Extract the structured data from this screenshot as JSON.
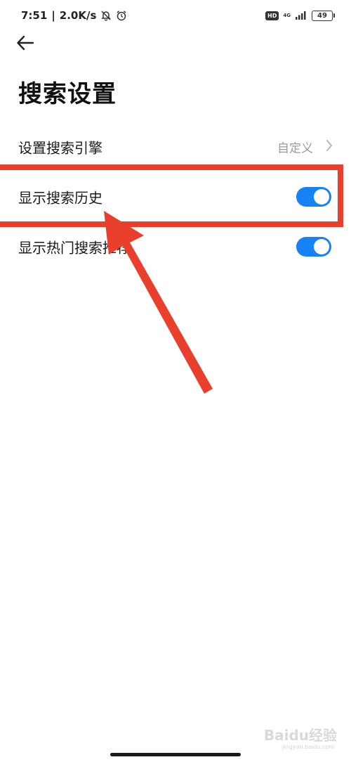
{
  "status_bar": {
    "time": "7:51",
    "network_speed": "2.0K/s",
    "hd_badge": "HD",
    "network_type": "4G",
    "battery": "49",
    "icons": [
      "notifications-off-icon",
      "alarm-icon",
      "signal-icon",
      "battery-icon"
    ]
  },
  "header": {
    "back_icon": "arrow-left-icon",
    "title": "搜索设置"
  },
  "settings": [
    {
      "label": "设置搜索引擎",
      "value": "自定义",
      "type": "link"
    },
    {
      "label": "显示搜索历史",
      "type": "toggle",
      "on": true
    },
    {
      "label": "显示热门搜索推荐",
      "type": "toggle",
      "on": true
    }
  ],
  "annotation": {
    "color": "#e8402c"
  },
  "colors": {
    "toggle_on": "#1683f5",
    "value_text": "#9a9a9a",
    "annotation_red": "#e8402c"
  },
  "watermark": {
    "brand": "Baidu经验",
    "domain": "jingyan.baidu.com"
  }
}
